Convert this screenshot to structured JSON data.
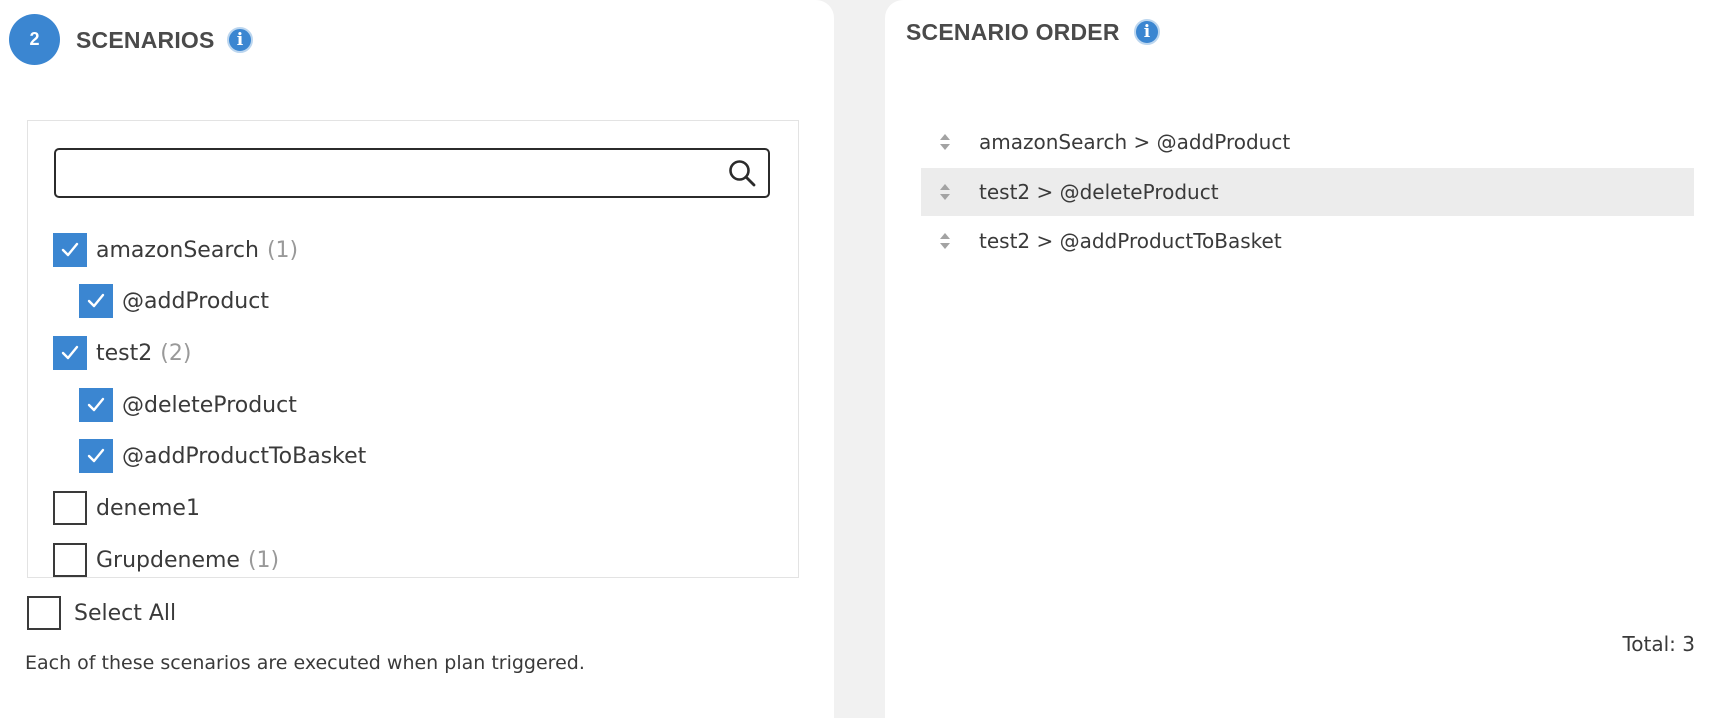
{
  "scenarios": {
    "step_number": "2",
    "title": "SCENARIOS",
    "info_icon": "i",
    "search": {
      "value": "",
      "placeholder": ""
    },
    "tree": [
      {
        "label": "amazonSearch",
        "count": "(1)",
        "checked": true,
        "level": 0
      },
      {
        "label": "@addProduct",
        "count": "",
        "checked": true,
        "level": 1
      },
      {
        "label": "test2",
        "count": "(2)",
        "checked": true,
        "level": 0
      },
      {
        "label": "@deleteProduct",
        "count": "",
        "checked": true,
        "level": 1
      },
      {
        "label": "@addProductToBasket",
        "count": "",
        "checked": true,
        "level": 1
      },
      {
        "label": "deneme1",
        "count": "",
        "checked": false,
        "level": 0
      },
      {
        "label": "Grupdeneme",
        "count": "(1)",
        "checked": false,
        "level": 0
      }
    ],
    "select_all_label": "Select All",
    "select_all_checked": false,
    "hint": "Each of these scenarios are executed when plan triggered."
  },
  "order": {
    "title": "SCENARIO ORDER",
    "info_icon": "i",
    "items": [
      {
        "label": "amazonSearch > @addProduct",
        "highlighted": false
      },
      {
        "label": "test2 > @deleteProduct",
        "highlighted": true
      },
      {
        "label": "test2 > @addProductToBasket",
        "highlighted": false
      }
    ],
    "total_label": "Total: 3"
  },
  "colors": {
    "accent": "#3b86d1",
    "row_highlight": "#ececec",
    "muted": "#999999"
  },
  "icons": {
    "search": "search-icon",
    "info": "info-icon",
    "check": "check-icon",
    "drag": "drag-handle-icon"
  }
}
